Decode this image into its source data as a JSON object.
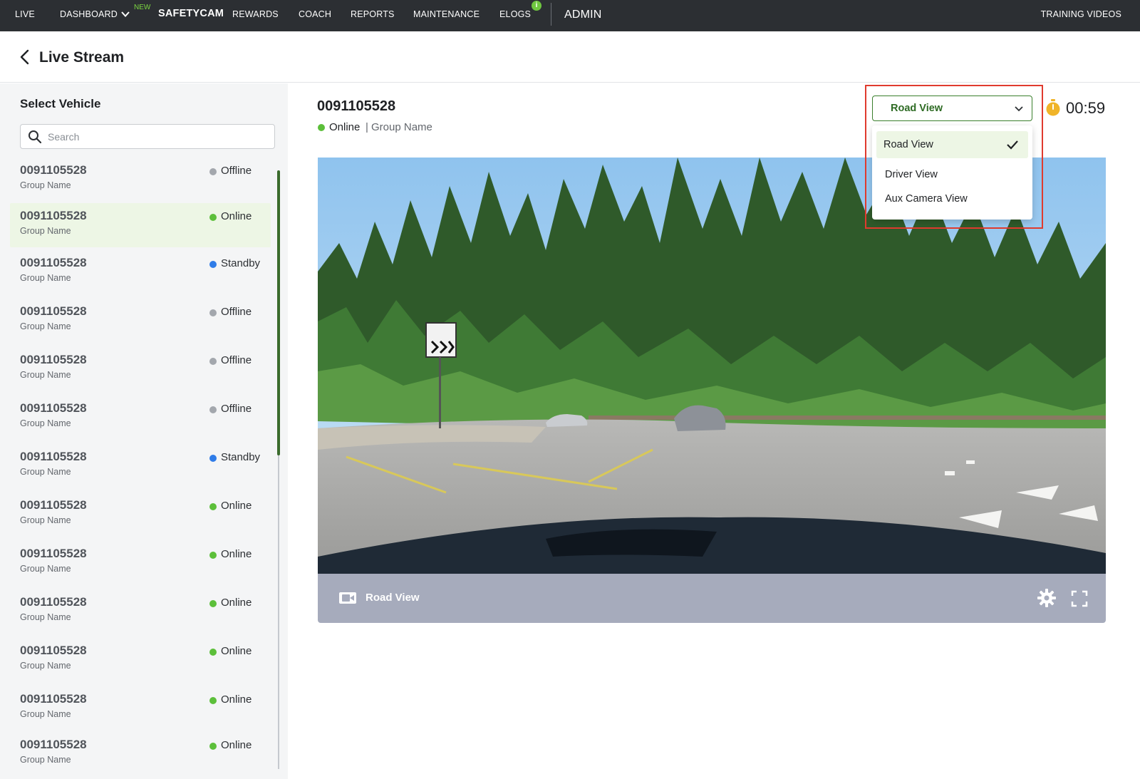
{
  "nav": {
    "live": "LIVE",
    "dashboard": "DASHBOARD",
    "new_badge": "NEW",
    "safetycam": "SAFETYCAM",
    "rewards": "REWARDS",
    "coach": "COACH",
    "reports": "REPORTS",
    "maintenance": "MAINTENANCE",
    "elogs": "ELOGS",
    "elogs_info": "i",
    "admin": "ADMIN",
    "training_videos": "TRAINING VIDEOS"
  },
  "header": {
    "title": "Live Stream"
  },
  "sidebar": {
    "title": "Select Vehicle",
    "search_placeholder": "Search",
    "vehicles": [
      {
        "id": "0091105528",
        "group": "Group Name",
        "status": "Offline"
      },
      {
        "id": "0091105528",
        "group": "Group Name",
        "status": "Online"
      },
      {
        "id": "0091105528",
        "group": "Group Name",
        "status": "Standby"
      },
      {
        "id": "0091105528",
        "group": "Group Name",
        "status": "Offline"
      },
      {
        "id": "0091105528",
        "group": "Group Name",
        "status": "Offline"
      },
      {
        "id": "0091105528",
        "group": "Group Name",
        "status": "Offline"
      },
      {
        "id": "0091105528",
        "group": "Group Name",
        "status": "Standby"
      },
      {
        "id": "0091105528",
        "group": "Group Name",
        "status": "Online"
      },
      {
        "id": "0091105528",
        "group": "Group Name",
        "status": "Online"
      },
      {
        "id": "0091105528",
        "group": "Group Name",
        "status": "Online"
      },
      {
        "id": "0091105528",
        "group": "Group Name",
        "status": "Online"
      },
      {
        "id": "0091105528",
        "group": "Group Name",
        "status": "Online"
      },
      {
        "id": "0091105528",
        "group": "Group Name",
        "status": "Online"
      }
    ],
    "selected_index": 1
  },
  "status_colors": {
    "Online": "#5cbf3a",
    "Offline": "#a3a7ad",
    "Standby": "#2f7ce8"
  },
  "main": {
    "vehicle_id": "0091105528",
    "status": "Online",
    "separator": "|",
    "group": "Group Name",
    "timer": "00:59",
    "view_select": {
      "selected": "Road View",
      "options": [
        "Road View",
        "Driver View",
        "Aux Camera View"
      ]
    },
    "video_bar": {
      "label": "Road View"
    }
  },
  "icons": {
    "back": "chevron-left-icon",
    "search": "search-icon",
    "timer": "stopwatch-icon",
    "camera": "video-camera-icon",
    "settings": "gear-icon",
    "fullscreen": "fullscreen-icon",
    "check": "check-icon",
    "chevron": "chevron-down-icon"
  },
  "colors": {
    "accent": "#2e6b24",
    "highlight_outline": "#e03b2e",
    "nav_bg": "#2c2f33"
  }
}
